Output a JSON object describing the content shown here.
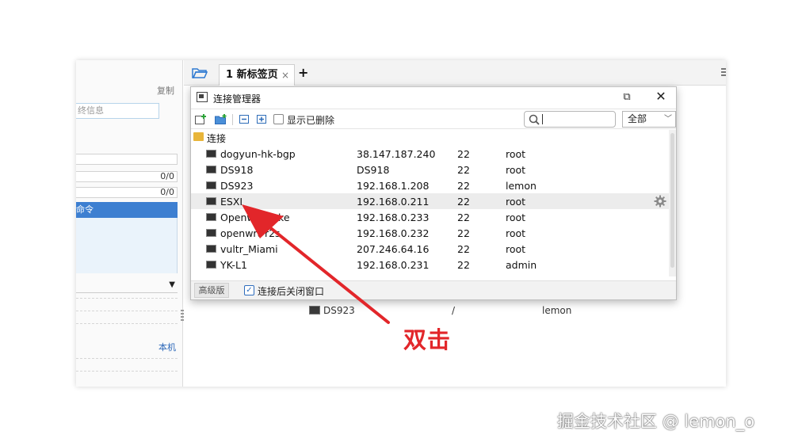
{
  "background_panel": {
    "copy_label": "复制",
    "info_placeholder": "终信息",
    "counter1": "0/0",
    "counter2": "0/0",
    "command_item": "命令",
    "local_label": "本机"
  },
  "tabbar": {
    "tab_label": "1 新标签页",
    "tab_close": "×",
    "new_tab": "+"
  },
  "background_row": {
    "name": "DS923",
    "separator": "/",
    "user": "lemon"
  },
  "dialog": {
    "title": "连接管理器",
    "restore_glyph": "⧉",
    "close_glyph": "✕",
    "toolbar": {
      "show_deleted_label": "显示已删除",
      "search_placeholder": "",
      "filter_value": "全部"
    },
    "group_label": "连接",
    "connections": [
      {
        "name": "dogyun-hk-bgp",
        "host": "38.147.187.240",
        "port": "22",
        "user": "root"
      },
      {
        "name": "DS918",
        "host": "DS918",
        "port": "22",
        "user": "root"
      },
      {
        "name": "DS923",
        "host": "192.168.1.208",
        "port": "22",
        "user": "lemon"
      },
      {
        "name": "ESXI",
        "host": "192.168.0.211",
        "port": "22",
        "user": "root"
      },
      {
        "name": "Openwrt-linke",
        "host": "192.168.0.233",
        "port": "22",
        "user": "root"
      },
      {
        "name": "openwrt-r2s",
        "host": "192.168.0.232",
        "port": "22",
        "user": "root"
      },
      {
        "name": "vultr_Miami",
        "host": "207.246.64.16",
        "port": "22",
        "user": "root"
      },
      {
        "name": "YK-L1",
        "host": "192.168.0.231",
        "port": "22",
        "user": "admin"
      }
    ],
    "highlighted_index": 3,
    "footer": {
      "advanced_label": "高级版",
      "close_after_connect_label": "连接后关闭窗口",
      "close_after_connect_checked": true
    }
  },
  "annotation": {
    "text": "双击",
    "color": "#e2262a"
  },
  "watermark": "掘金技术社区 @ lemon_o",
  "colors": {
    "accent_blue": "#3d7fd1",
    "row_highlight": "#ececec",
    "folder_yellow": "#e8b53a"
  }
}
